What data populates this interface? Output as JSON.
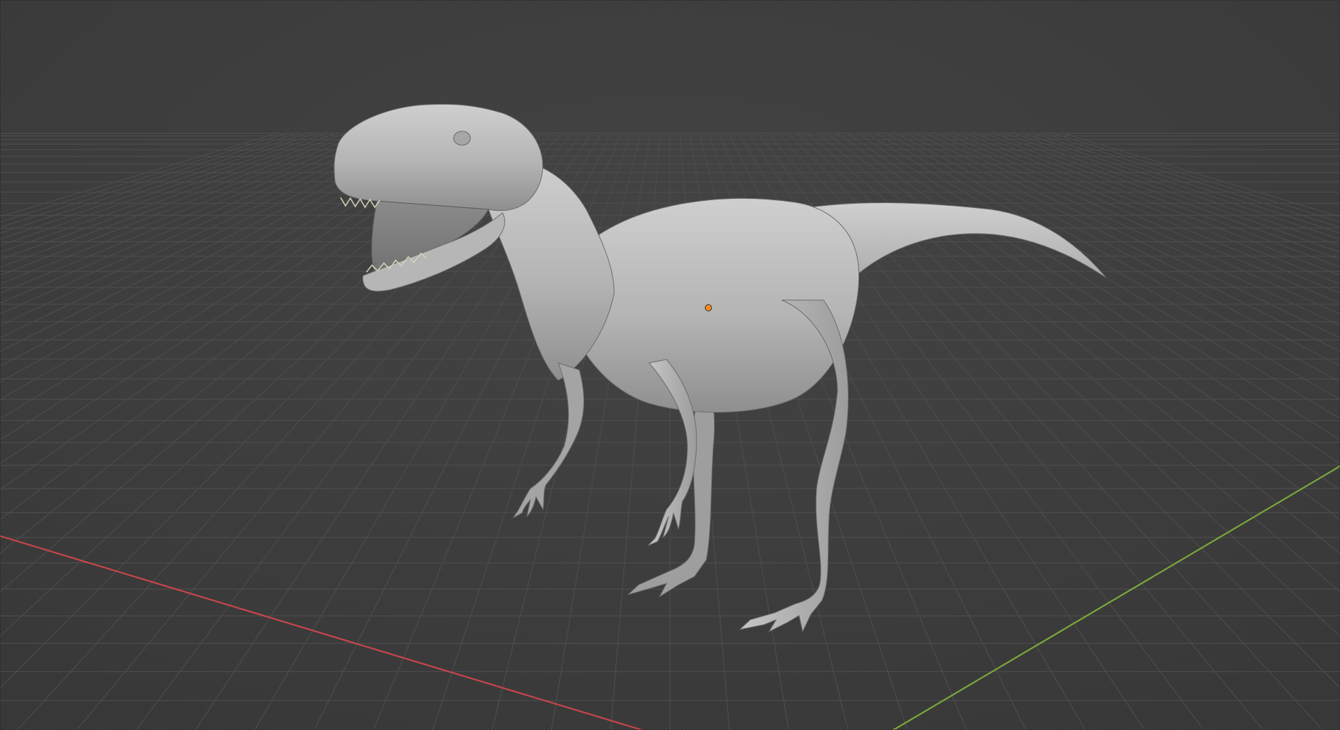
{
  "app": {
    "editor": "3D Viewport"
  },
  "scene": {
    "object": "dinosaur-mesh",
    "shading": "solid",
    "origin_marker_color": "#ff8c1a",
    "mesh_color": "#b9b9b9",
    "background_color": "#3d3d3d",
    "grid_color": "#4b4b4b",
    "x_axis_color": "#c8454b",
    "y_axis_color": "#7da83a"
  }
}
